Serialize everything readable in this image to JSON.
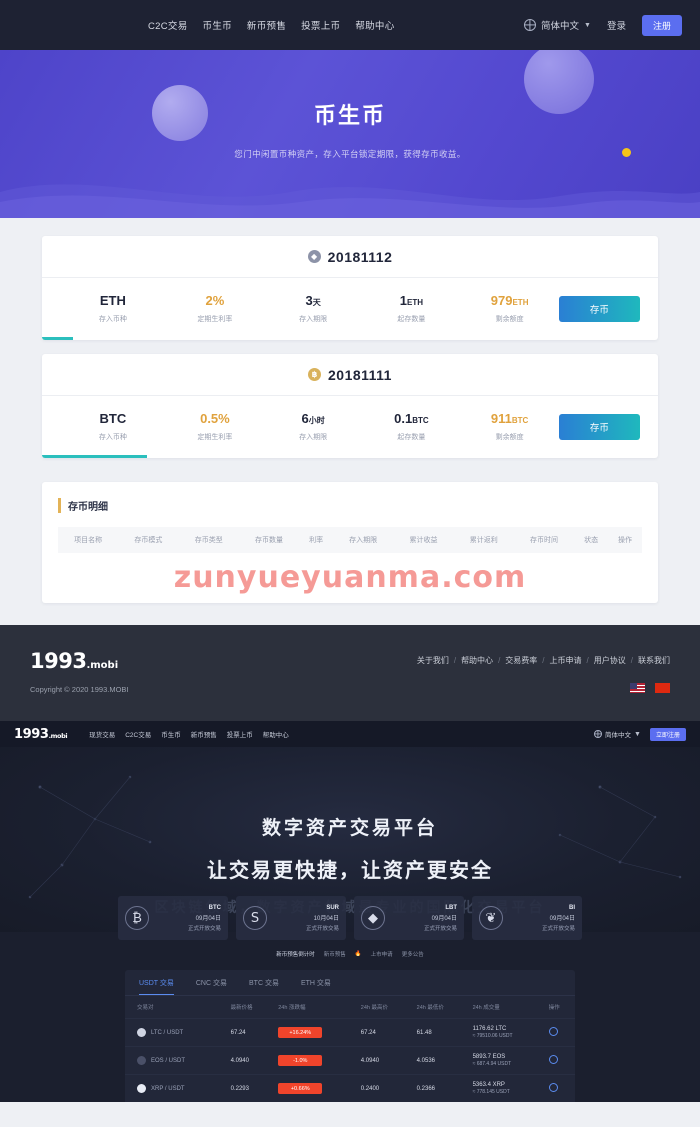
{
  "nav": {
    "links": [
      "C2C交易",
      "币生币",
      "新币预售",
      "投票上币",
      "帮助中心"
    ],
    "language": "简体中文",
    "login": "登录",
    "register": "注册",
    "globe_icon": "globe-icon",
    "caret_icon": "chevron-down-icon"
  },
  "hero": {
    "title": "币生币",
    "subtitle": "您门中闲置币种资产，存入平台锁定期限，获得存币收益。"
  },
  "deposits": [
    {
      "id": "20181112",
      "coin_icon": "eth-coin-icon",
      "stats": [
        {
          "value": "ETH",
          "unit": "",
          "label": "存入币种",
          "accent": false
        },
        {
          "value": "2%",
          "unit": "",
          "label": "定期生利率",
          "accent": true
        },
        {
          "value": "3",
          "unit": "天",
          "label": "存入期限",
          "accent": false
        },
        {
          "value": "1",
          "unit": "ETH",
          "label": "起存数量",
          "accent": false
        },
        {
          "value": "979",
          "unit": "ETH",
          "label": "剩余额度",
          "accent": true
        }
      ],
      "button": "存币",
      "progress": "5%"
    },
    {
      "id": "20181111",
      "coin_icon": "btc-coin-icon",
      "stats": [
        {
          "value": "BTC",
          "unit": "",
          "label": "存入币种",
          "accent": false
        },
        {
          "value": "0.5%",
          "unit": "",
          "label": "定期生利率",
          "accent": true
        },
        {
          "value": "6",
          "unit": "小时",
          "label": "存入期限",
          "accent": false
        },
        {
          "value": "0.1",
          "unit": "BTC",
          "label": "起存数量",
          "accent": false
        },
        {
          "value": "911",
          "unit": "BTC",
          "label": "剩余额度",
          "accent": true
        }
      ],
      "button": "存币",
      "progress": "17%"
    }
  ],
  "record": {
    "title": "存币明细",
    "columns": [
      "项目名称",
      "存币模式",
      "存币类型",
      "存币数量",
      "利率",
      "存入期限",
      "累计收益",
      "累计返利",
      "存币时间",
      "状态",
      "操作"
    ],
    "rows": [],
    "watermark": "zunyueyuanma.com"
  },
  "footer": {
    "brand": "1993",
    "brand_suffix": ".mobi",
    "copyright": "Copyright © 2020 1993.MOBI",
    "links": [
      "关于我们",
      "帮助中心",
      "交易费率",
      "上币申请",
      "用户协议",
      "联系我们"
    ],
    "flags": [
      "us-flag-icon",
      "cn-flag-icon"
    ]
  },
  "page2": {
    "nav": {
      "brand": "1993",
      "brand_suffix": ".mobi",
      "links": [
        "现货交易",
        "C2C交易",
        "币生币",
        "新币预售",
        "投票上币",
        "帮助中心"
      ],
      "language": "简体中文",
      "register": "立即注册"
    },
    "hero": {
      "line1": "数字资产交易平台",
      "line2": "让交易更快捷，让资产更安全",
      "line3": "区块链领域，数字资产领域最专业的国际化交易平台"
    },
    "coins": [
      {
        "icon": "bitcoin-icon",
        "glyph": "₿",
        "name": "BTC",
        "date": "09月04日",
        "status": "正式开放交易"
      },
      {
        "icon": "siacoin-icon",
        "glyph": "S",
        "name": "SUR",
        "date": "10月04日",
        "status": "正式开放交易"
      },
      {
        "icon": "ethereum-icon",
        "glyph": "◆",
        "name": "LBT",
        "date": "09月04日",
        "status": "正式开放交易"
      },
      {
        "icon": "bull-icon",
        "glyph": "❦",
        "name": "BI",
        "date": "09月04日",
        "status": "正式开放交易"
      }
    ],
    "sub_tabs": [
      "新币预售倒计时",
      "新币预售",
      "上市申请",
      "更多公告"
    ],
    "market": {
      "tabs": [
        "USDT 交易",
        "CNC 交易",
        "BTC 交易",
        "ETH 交易"
      ],
      "active_tab": "USDT 交易",
      "columns": [
        "交易对",
        "最新价格",
        "24h 涨跌幅",
        "24h 最高价",
        "24h 最低价",
        "24h 成交量",
        "操作"
      ],
      "rows": [
        {
          "pair": "LTC / USDT",
          "price": "67.24",
          "change": "+16.24%",
          "high": "67.24",
          "low": "61.48",
          "vol": "1176.62 LTC",
          "vol2": "≈ 79510.06 USDT",
          "icon": "ltc-icon"
        },
        {
          "pair": "EOS / USDT",
          "price": "4.0940",
          "change": "-1.0%",
          "high": "4.0940",
          "low": "4.0536",
          "vol": "5893.7 EOS",
          "vol2": "≈ 687.4.94 USDT",
          "icon": "eos-icon"
        },
        {
          "pair": "XRP / USDT",
          "price": "0.2293",
          "change": "+0.66%",
          "high": "0.2400",
          "low": "0.2366",
          "vol": "5363.4 XRP",
          "vol2": "≈ 778.145 USDT",
          "icon": "xrp-icon"
        }
      ]
    }
  },
  "colors": {
    "brand_purple": "#5348cf",
    "accent_gold": "#e0a23d",
    "accent_teal": "#2bbfbd",
    "accent_blue": "#5b6ef0",
    "up_red": "#f0442b",
    "watermark_pink": "#f4857f"
  }
}
